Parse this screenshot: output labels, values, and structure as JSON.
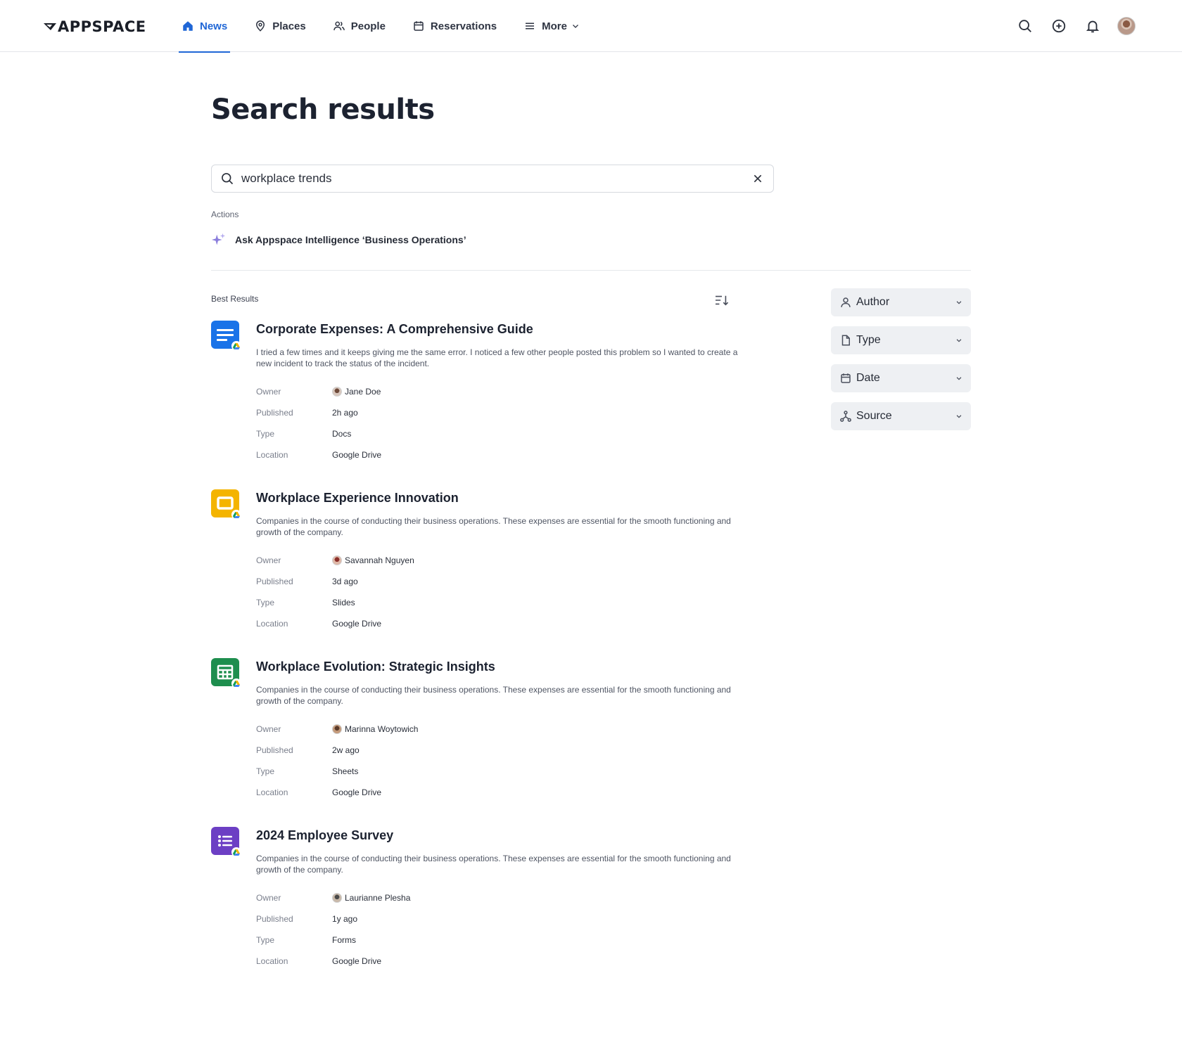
{
  "brand": {
    "name": "APPSPACE"
  },
  "nav": {
    "items": [
      {
        "label": "News",
        "icon": "home-icon",
        "active": true
      },
      {
        "label": "Places",
        "icon": "location-pin-icon",
        "active": false
      },
      {
        "label": "People",
        "icon": "people-icon",
        "active": false
      },
      {
        "label": "Reservations",
        "icon": "calendar-icon",
        "active": false
      },
      {
        "label": "More",
        "icon": "menu-icon",
        "active": false
      }
    ],
    "accent_color": "#1f66d6"
  },
  "header_actions": [
    "search-icon",
    "add-circle-icon",
    "bell-icon",
    "avatar"
  ],
  "page": {
    "title": "Search results"
  },
  "search": {
    "value": "workplace trends"
  },
  "actions": {
    "label": "Actions",
    "ai_action_label": "Ask Appspace Intelligence  ‘Business Operations’"
  },
  "results_section": {
    "label": "Best Results"
  },
  "meta_labels": {
    "owner": "Owner",
    "published": "Published",
    "type": "Type",
    "location": "Location"
  },
  "results": [
    {
      "title": "Corporate Expenses: A Comprehensive Guide",
      "description": "I tried a few times and it keeps giving me the same error. I noticed a few other people posted this problem so I wanted to create a new incident to track the status of the incident.",
      "owner": "Jane Doe",
      "published": "2h ago",
      "type": "Docs",
      "location": "Google Drive",
      "icon": "docs-icon",
      "color": "#1a73e8"
    },
    {
      "title": "Workplace Experience Innovation",
      "description": "Companies in the course of conducting their business operations. These expenses are essential for the smooth functioning and growth of the company.",
      "owner": "Savannah Nguyen",
      "published": "3d ago",
      "type": "Slides",
      "location": "Google Drive",
      "icon": "slides-icon",
      "color": "#f4b400"
    },
    {
      "title": "Workplace Evolution: Strategic Insights",
      "description": "Companies in the course of conducting their business operations. These expenses are essential for the smooth functioning and growth of the company.",
      "owner": "Marinna Woytowich",
      "published": "2w ago",
      "type": "Sheets",
      "location": "Google Drive",
      "icon": "sheets-icon",
      "color": "#1e8e4e"
    },
    {
      "title": "2024 Employee Survey",
      "description": "Companies in the course of conducting their business operations. These expenses are essential for the smooth functioning and growth of the company.",
      "owner": "Laurianne Plesha",
      "published": "1y ago",
      "type": "Forms",
      "location": "Google Drive",
      "icon": "forms-icon",
      "color": "#6c3fc4"
    }
  ],
  "filters": [
    {
      "label": "Author",
      "icon": "person-icon"
    },
    {
      "label": "Type",
      "icon": "file-icon"
    },
    {
      "label": "Date",
      "icon": "calendar-icon"
    },
    {
      "label": "Source",
      "icon": "source-network-icon"
    }
  ]
}
